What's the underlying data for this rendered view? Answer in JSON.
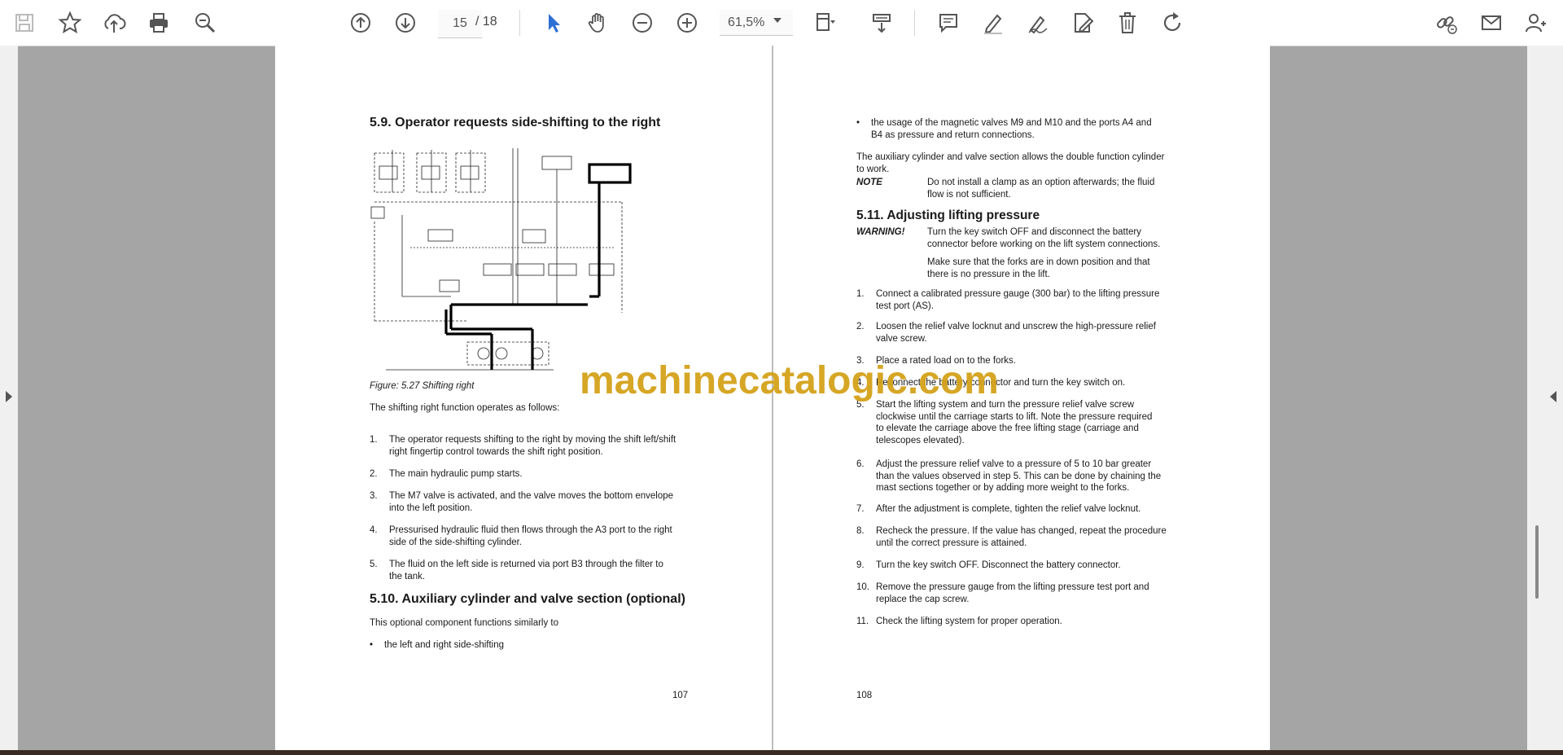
{
  "toolbar": {
    "page_current": "15",
    "page_separator": "/ 18",
    "zoom": "61,5%"
  },
  "left_page": {
    "heading": "5.9. Operator requests side-shifting to the right",
    "figure_caption": "Figure: 5.27 Shifting right",
    "intro": "The shifting right function operates as follows:",
    "steps": [
      {
        "n": "1.",
        "l1": "The operator requests shifting to the right by moving the shift left/shift",
        "l2": "right fingertip control towards the shift right position."
      },
      {
        "n": "2.",
        "l1": "The main hydraulic pump starts.",
        "l2": ""
      },
      {
        "n": "3.",
        "l1": "The M7 valve is activated, and the valve moves the bottom envelope",
        "l2": "into the left position."
      },
      {
        "n": "4.",
        "l1": "Pressurised hydraulic fluid then flows through the A3 port to the right",
        "l2": "side of the side-shifting cylinder."
      },
      {
        "n": "5.",
        "l1": "The fluid on the left side is returned via port B3 through the filter to",
        "l2": "the tank."
      }
    ],
    "heading2": "5.10. Auxiliary cylinder and valve section (optional)",
    "para2": "This optional component functions similarly to",
    "bullet": "the left and right side-shifting",
    "page_number": "107"
  },
  "right_page": {
    "bullet_l1": "the usage of the magnetic valves M9 and M10 and the ports A4 and",
    "bullet_l2": "B4 as pressure and return connections.",
    "para_l1": "The auxiliary cylinder and valve section allows the double function cylinder",
    "para_l2": "to work.",
    "note_label": "NOTE",
    "note_l1": "Do not install a clamp as an option afterwards; the fluid",
    "note_l2": "flow is not sufficient.",
    "heading": "5.11. Adjusting lifting pressure",
    "warning_label": "WARNING!",
    "warn_l1": "Turn the key switch OFF and disconnect the battery",
    "warn_l2": "connector before working on the lift system connections.",
    "warn_l3": "Make sure that the forks are in down position and that",
    "warn_l4": "there is no pressure in the lift.",
    "steps": [
      {
        "n": "1.",
        "l1": "Connect a calibrated pressure gauge (300 bar) to the lifting pressure",
        "l2": "test port (AS).",
        "l3": ""
      },
      {
        "n": "2.",
        "l1": "Loosen the relief valve locknut and unscrew the high-pressure relief",
        "l2": "valve screw.",
        "l3": ""
      },
      {
        "n": "3.",
        "l1": "Place a rated load on to the forks.",
        "l2": "",
        "l3": ""
      },
      {
        "n": "4.",
        "l1": "Reconnect the battery connector and turn the key switch on.",
        "l2": "",
        "l3": ""
      },
      {
        "n": "5.",
        "l1": "Start the lifting system and turn the pressure relief valve screw",
        "l2": "clockwise until the carriage starts to lift. Note the pressure required",
        "l3": "to elevate the carriage above the free lifting stage (carriage and",
        "l4": "telescopes elevated)."
      },
      {
        "n": "6.",
        "l1": "Adjust the pressure relief valve to a pressure of 5 to 10 bar greater",
        "l2": "than the values observed in step 5. This can be done by chaining the",
        "l3": "mast sections together or by adding more weight to the forks."
      },
      {
        "n": "7.",
        "l1": "After the adjustment is complete, tighten the relief valve locknut.",
        "l2": "",
        "l3": ""
      },
      {
        "n": "8.",
        "l1": "Recheck the pressure. If the value has changed, repeat the procedure",
        "l2": "until the correct pressure is attained.",
        "l3": ""
      },
      {
        "n": "9.",
        "l1": "Turn the key switch OFF. Disconnect the battery connector.",
        "l2": "",
        "l3": ""
      },
      {
        "n": "10.",
        "l1": "Remove the pressure gauge from the lifting pressure test port and",
        "l2": "replace the cap screw.",
        "l3": ""
      },
      {
        "n": "11.",
        "l1": "Check the lifting system for proper operation.",
        "l2": "",
        "l3": ""
      }
    ],
    "page_number": "108"
  },
  "watermark": "machinecatalogic.com"
}
